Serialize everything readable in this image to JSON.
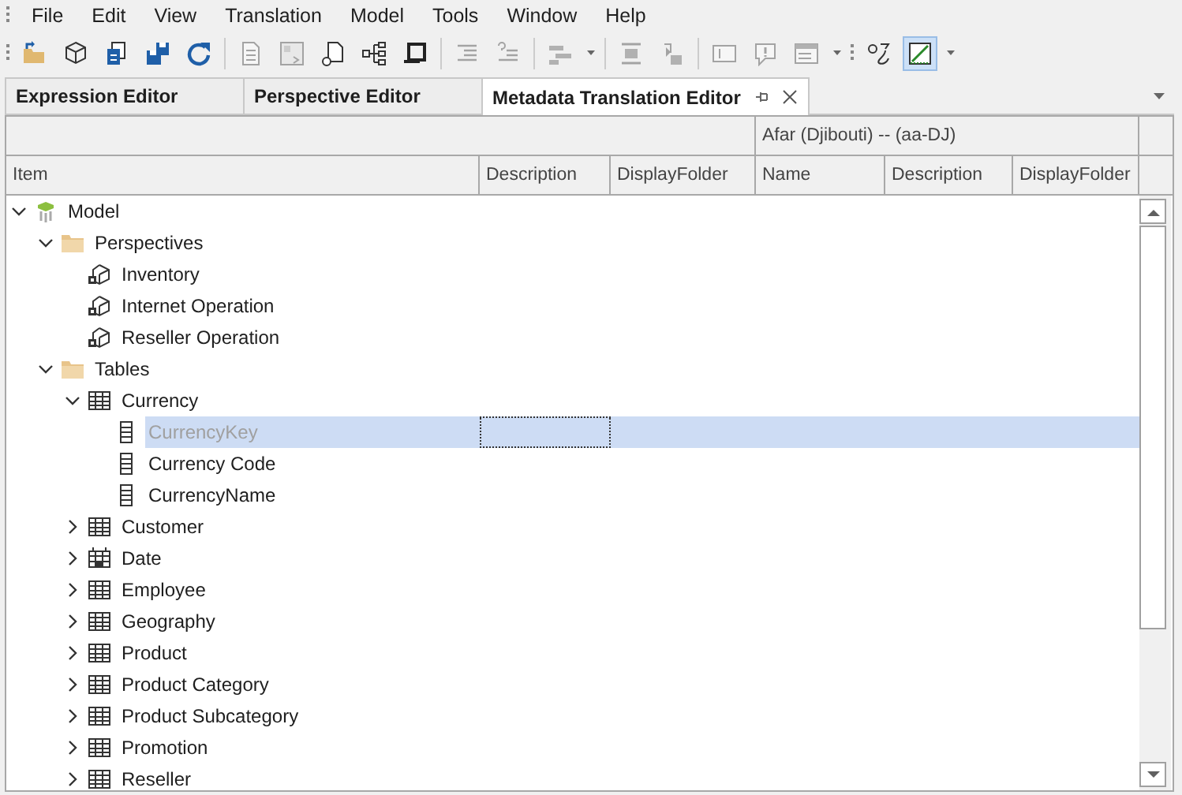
{
  "menu": [
    "File",
    "Edit",
    "View",
    "Translation",
    "Model",
    "Tools",
    "Window",
    "Help"
  ],
  "toolbar": {
    "groups": [
      [
        {
          "disabled": false,
          "pressed": false,
          "dropdown": false
        },
        {
          "disabled": false,
          "pressed": false,
          "dropdown": false
        },
        {
          "disabled": false,
          "pressed": false,
          "dropdown": false
        },
        {
          "disabled": false,
          "pressed": false,
          "dropdown": false
        },
        {
          "disabled": false,
          "pressed": false,
          "dropdown": false
        }
      ],
      [
        {
          "disabled": true,
          "pressed": false,
          "dropdown": false
        },
        {
          "disabled": true,
          "pressed": false,
          "dropdown": false
        },
        {
          "disabled": false,
          "pressed": false,
          "dropdown": false
        },
        {
          "disabled": false,
          "pressed": false,
          "dropdown": false
        },
        {
          "disabled": false,
          "pressed": false,
          "dropdown": false
        }
      ],
      [
        {
          "disabled": true,
          "pressed": false,
          "dropdown": false
        },
        {
          "disabled": true,
          "pressed": false,
          "dropdown": false
        }
      ],
      [
        {
          "disabled": true,
          "pressed": false,
          "dropdown": true
        }
      ],
      [
        {
          "disabled": true,
          "pressed": false,
          "dropdown": false
        },
        {
          "disabled": true,
          "pressed": false,
          "dropdown": false
        }
      ],
      [
        {
          "disabled": true,
          "pressed": false,
          "dropdown": false
        },
        {
          "disabled": true,
          "pressed": false,
          "dropdown": false
        },
        {
          "disabled": true,
          "pressed": false,
          "dropdown": true
        }
      ],
      [
        {
          "disabled": false,
          "pressed": false,
          "dropdown": false
        },
        {
          "disabled": false,
          "pressed": true,
          "dropdown": true
        }
      ]
    ]
  },
  "tabs": [
    {
      "label": "Expression Editor",
      "selected": false
    },
    {
      "label": "Perspective Editor",
      "selected": false
    },
    {
      "label": "Metadata Translation Editor",
      "selected": true
    }
  ],
  "grid": {
    "language": "Afar (Djibouti) -- (aa-DJ)",
    "columns": [
      {
        "label": "Item",
        "focused": false
      },
      {
        "label": "Description",
        "focused": true
      },
      {
        "label": "DisplayFolder",
        "focused": false
      },
      {
        "label": "Name",
        "focused": false
      },
      {
        "label": "Description",
        "focused": false
      },
      {
        "label": "DisplayFolder",
        "focused": false
      }
    ],
    "tree": [
      {
        "label": "Model",
        "kind": "model",
        "expanded": true,
        "selected": false,
        "children": [
          {
            "label": "Perspectives",
            "kind": "folder",
            "expanded": true,
            "selected": false,
            "children": [
              {
                "label": "Inventory",
                "kind": "perspective",
                "selected": false
              },
              {
                "label": "Internet Operation",
                "kind": "perspective",
                "selected": false
              },
              {
                "label": "Reseller Operation",
                "kind": "perspective",
                "selected": false
              }
            ]
          },
          {
            "label": "Tables",
            "kind": "folder",
            "expanded": true,
            "selected": false,
            "children": [
              {
                "label": "Currency",
                "kind": "table",
                "expanded": true,
                "selected": false,
                "children": [
                  {
                    "label": "CurrencyKey",
                    "kind": "column",
                    "selected": true,
                    "hidden": true
                  },
                  {
                    "label": "Currency Code",
                    "kind": "column",
                    "selected": false,
                    "hidden": false
                  },
                  {
                    "label": "CurrencyName",
                    "kind": "column",
                    "selected": false,
                    "hidden": false
                  }
                ]
              },
              {
                "label": "Customer",
                "kind": "table",
                "expanded": false,
                "selected": false
              },
              {
                "label": "Date",
                "kind": "date_table",
                "expanded": false,
                "selected": false
              },
              {
                "label": "Employee",
                "kind": "table",
                "expanded": false,
                "selected": false
              },
              {
                "label": "Geography",
                "kind": "table",
                "expanded": false,
                "selected": false
              },
              {
                "label": "Product",
                "kind": "table",
                "expanded": false,
                "selected": false
              },
              {
                "label": "Product Category",
                "kind": "table",
                "expanded": false,
                "selected": false
              },
              {
                "label": "Product Subcategory",
                "kind": "table",
                "expanded": false,
                "selected": false
              },
              {
                "label": "Promotion",
                "kind": "table",
                "expanded": false,
                "selected": false
              },
              {
                "label": "Reseller",
                "kind": "table",
                "expanded": false,
                "selected": false
              }
            ]
          }
        ]
      }
    ]
  }
}
